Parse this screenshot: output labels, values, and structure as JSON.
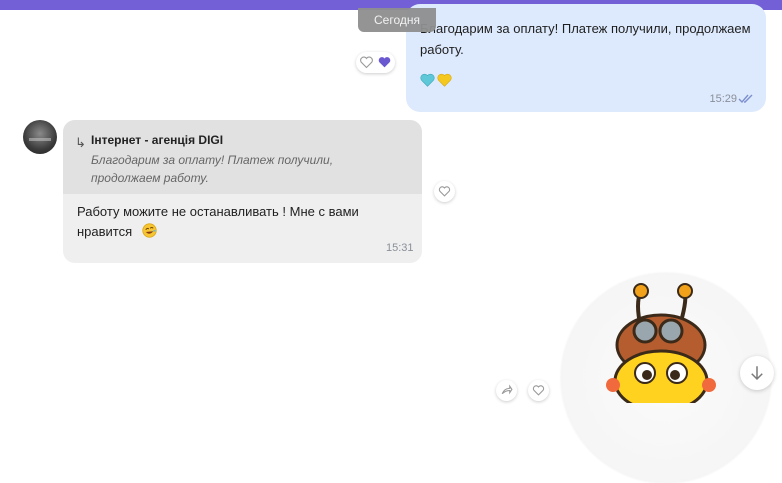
{
  "date_separator": "Сегодня",
  "outgoing": {
    "text": "Благодарим за оплату! Платеж получили, продолжаем работу.",
    "time": "15:29",
    "emoji_hearts": [
      "light-blue-heart-icon",
      "yellow-heart-icon"
    ],
    "reaction_icon": "purple-heart-icon"
  },
  "incoming": {
    "quote_author": "Інтернет - агенція DIGI",
    "quote_text": "Благодарим за оплату! Платеж получили, продолжаем работу.",
    "text": "Работу можите не останавливать ! Мне с вами нравится",
    "emoji": "rofl-emoji-icon",
    "time": "15:31"
  },
  "colors": {
    "accent": "#7360d6",
    "outgoing_bubble": "#ddeafd",
    "incoming_bubble": "#efefef",
    "quote_bg": "#e1e1e1"
  }
}
